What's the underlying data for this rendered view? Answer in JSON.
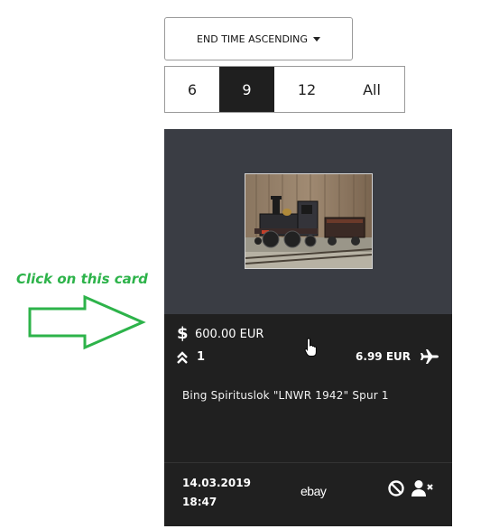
{
  "sort": {
    "label": "END TIME ASCENDING",
    "caret_icon": "caret-down-icon"
  },
  "page_size": {
    "options": [
      "6",
      "9",
      "12",
      "All"
    ],
    "selected": "9"
  },
  "card": {
    "image_icon": "train-photo",
    "price": "600.00 EUR",
    "price_icon": "dollar-icon",
    "bids": "1",
    "bids_icon": "double-chevron-up-icon",
    "shipping": "6.99 EUR",
    "shipping_icon": "airplane-icon",
    "title": "Bing Spirituslok \"LNWR 1942\" Spur 1",
    "end_date": "14.03.2019",
    "end_time": "18:47",
    "platform": "ebay",
    "actions": [
      "block-icon",
      "remove-user-icon"
    ]
  },
  "annotation": {
    "text": "Click on this card",
    "color": "#2db34a"
  },
  "colors": {
    "card_bg": "#202020",
    "card_top_bg": "#3a3d44",
    "selected_bg": "#1f1f1f"
  }
}
